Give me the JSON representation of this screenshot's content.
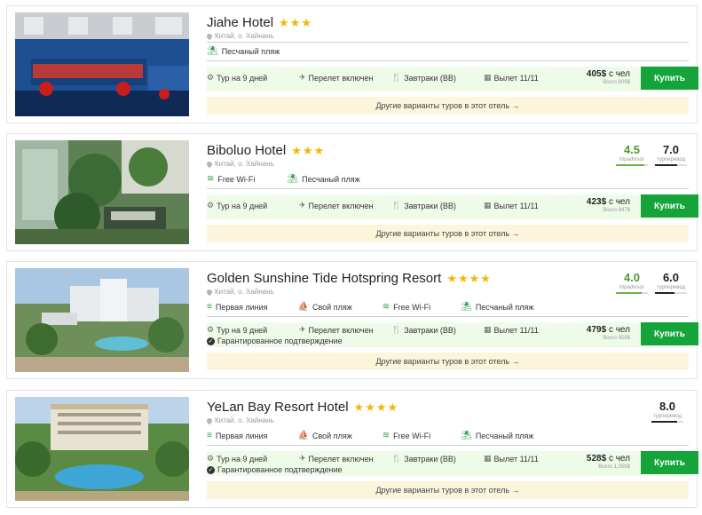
{
  "hotels": [
    {
      "name": "Jiahe Hotel",
      "stars": 3,
      "location": "Китай, о. Хайнань",
      "amenities": [
        "Песчаный пляж"
      ],
      "amenity_icons": [
        "palm-icon"
      ],
      "tour": {
        "duration": "Тур на 9 дней",
        "flight": "Перелет включен",
        "meals": "Завтраки (BB)",
        "departure": "Вылет 11/11",
        "price": "405$",
        "price_unit": "с чел",
        "price_total": "Всего 809$"
      },
      "buy_label": "Купить",
      "other_tours": "Другие варианты туров в этот отель →"
    },
    {
      "name": "Biboluo Hotel",
      "stars": 3,
      "location": "Китай, о. Хайнань",
      "amenities": [
        "Free Wi-Fi",
        "Песчаный пляж"
      ],
      "amenity_icons": [
        "wifi-icon",
        "palm-icon"
      ],
      "ratings": {
        "tripadvisor": {
          "value": "4.5",
          "label": "tripadvisor",
          "fill": 0.9
        },
        "turtella": {
          "value": "7.0",
          "label": "турперевод",
          "fill": 0.7
        }
      },
      "tour": {
        "duration": "Тур на 9 дней",
        "flight": "Перелет включен",
        "meals": "Завтраки (BB)",
        "departure": "Вылет 11/11",
        "price": "423$",
        "price_unit": "с чел",
        "price_total": "Всего 847$"
      },
      "buy_label": "Купить",
      "other_tours": "Другие варианты туров в этот отель →"
    },
    {
      "name": "Golden Sunshine Tide Hotspring Resort",
      "stars": 4,
      "location": "Китай, о. Хайнань",
      "amenities": [
        "Первая линия",
        "Свой пляж",
        "Free Wi-Fi",
        "Песчаный пляж"
      ],
      "amenity_icons": [
        "waves-icon",
        "beach-icon",
        "wifi-icon",
        "palm-icon"
      ],
      "ratings": {
        "tripadvisor": {
          "value": "4.0",
          "label": "tripadvisor",
          "fill": 0.8
        },
        "turtella": {
          "value": "6.0",
          "label": "турперевод",
          "fill": 0.6
        }
      },
      "tour": {
        "duration": "Тур на 9 дней",
        "guarantee": "Гарантированное подтверждение",
        "flight": "Перелет включен",
        "meals": "Завтраки (BB)",
        "departure": "Вылет 11/11",
        "price": "479$",
        "price_unit": "с чел",
        "price_total": "Всего 958$"
      },
      "buy_label": "Купить",
      "other_tours": "Другие варианты туров в этот отель →"
    },
    {
      "name": "YeLan Bay Resort Hotel",
      "stars": 4,
      "location": "Китай, о. Хайнань",
      "amenities": [
        "Первая линия",
        "Свой пляж",
        "Free Wi-Fi",
        "Песчаный пляж"
      ],
      "amenity_icons": [
        "waves-icon",
        "beach-icon",
        "wifi-icon",
        "palm-icon"
      ],
      "ratings": {
        "turtella": {
          "value": "8.0",
          "label": "турперевод",
          "fill": 0.8
        }
      },
      "tour": {
        "duration": "Тур на 9 дней",
        "guarantee": "Гарантированное подтверждение",
        "flight": "Перелет включен",
        "meals": "Завтраки (BB)",
        "departure": "Вылет 11/11",
        "price": "528$",
        "price_unit": "с чел",
        "price_total": "Всего 1,056$"
      },
      "buy_label": "Купить",
      "other_tours": "Другие варианты туров в этот отель →"
    }
  ],
  "colors": {
    "accent_green": "#14a43a",
    "tour_bg": "#effbe9",
    "other_bg": "#fbf5dc",
    "star": "#f2b705",
    "tripadvisor_green": "#4f9a2e"
  }
}
